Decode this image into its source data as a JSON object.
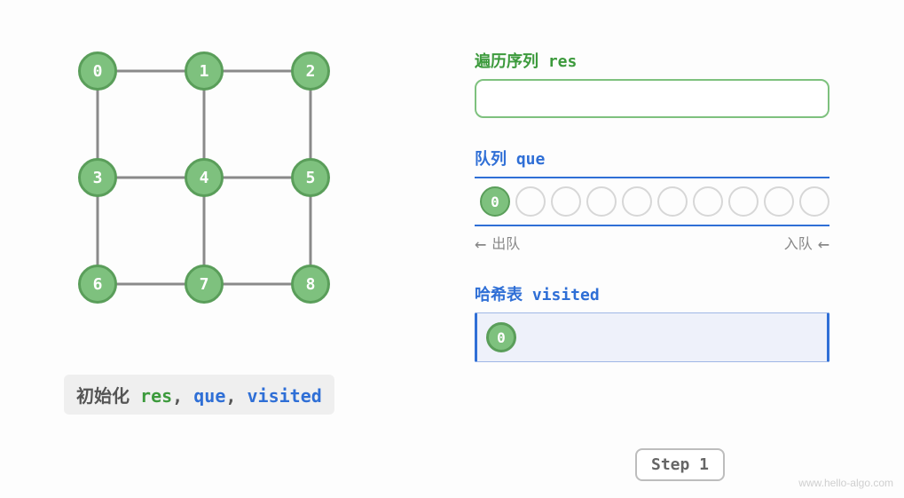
{
  "graph": {
    "nodes": [
      "0",
      "1",
      "2",
      "3",
      "4",
      "5",
      "6",
      "7",
      "8"
    ]
  },
  "caption": {
    "prefix": "初始化",
    "res": "res",
    "que": "que",
    "visited": "visited",
    "sep": ","
  },
  "res": {
    "title": "遍历序列 res",
    "items": []
  },
  "queue": {
    "title": "队列 que",
    "slots": 10,
    "items": [
      "0"
    ],
    "dequeue_label": "出队",
    "enqueue_label": "入队"
  },
  "visited": {
    "title": "哈希表 visited",
    "items": [
      "0"
    ]
  },
  "step": {
    "label": "Step 1"
  },
  "watermark": "www.hello-algo.com"
}
